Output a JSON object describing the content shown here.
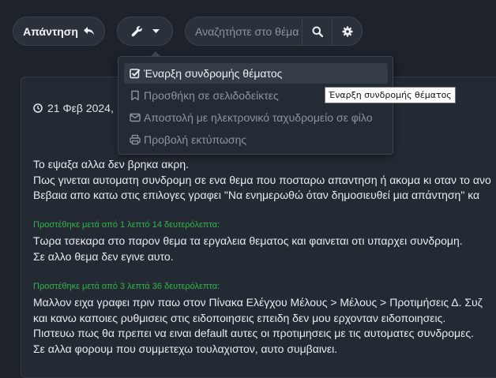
{
  "toolbar": {
    "reply_label": "Απάντηση",
    "search_placeholder": "Αναζητήστε στο θέμα"
  },
  "tools_menu": {
    "items": [
      {
        "label": "Έναρξη συνδρομής θέματος",
        "icon": "checked-box-icon"
      },
      {
        "label": "Προσθήκη σε σελιδοδείκτες",
        "icon": "bookmark-icon"
      },
      {
        "label": "Αποστολή με ηλεκτρονικό ταχυδρομείο σε φίλο",
        "icon": "envelope-icon"
      },
      {
        "label": "Προβολή εκτύπωσης",
        "icon": "print-icon"
      }
    ]
  },
  "tooltip": "Έναρξη συνδρομής θέματος",
  "post": {
    "date": "21 Φεβ 2024, 1",
    "lines1": [
      "Το εψαξα αλλα δεν βρηκα ακρη.",
      "Πως γινεται αυτοματη συνδρομη σε ενα θεμα που ποσταρω απαντηση ή ακομα κι οταν το ανο",
      "Βεβαια απο κατω στις επιλογες γραφει \"Να ενημερωθώ όταν δημοσιευθεί μια απάντηση\" κα"
    ],
    "added1": "Προστέθηκε μετά από 1 λεπτό 14 δευτερόλεπτα:",
    "lines2": [
      "Τωρα τσεκαρα στο παρον θεμα τα εργαλεια θεματος και φαινεται οτι υπαρχει συνδρομη.",
      "Σε αλλο θεμα δεν εγινε αυτο."
    ],
    "added2": "Προστέθηκε μετά από 3 λεπτά 36 δευτερόλεπτα:",
    "lines3": [
      "Μαλλον ειχα γραφει πριν παω στον Πίνακα Ελέγχου Μέλους > Μέλους > Προτιμήσεις Δ. Συζ",
      "και κανω καποιες ρυθμισεις στις ειδοποιησεις επειδη δεν μου ερχονταν ειδοποιησεις.",
      "Πιστευω πως θα πρεπει να ειναι default αυτες οι προτιμησεις με τις αυτοματες συνδρομες.",
      "Σε αλλα φορουμ που συμμετεχω τουλαχιστον, αυτο συμβαινει."
    ]
  },
  "colors": {
    "background": "#1d222b",
    "panel": "#242a33",
    "added_note": "#34b34a"
  }
}
